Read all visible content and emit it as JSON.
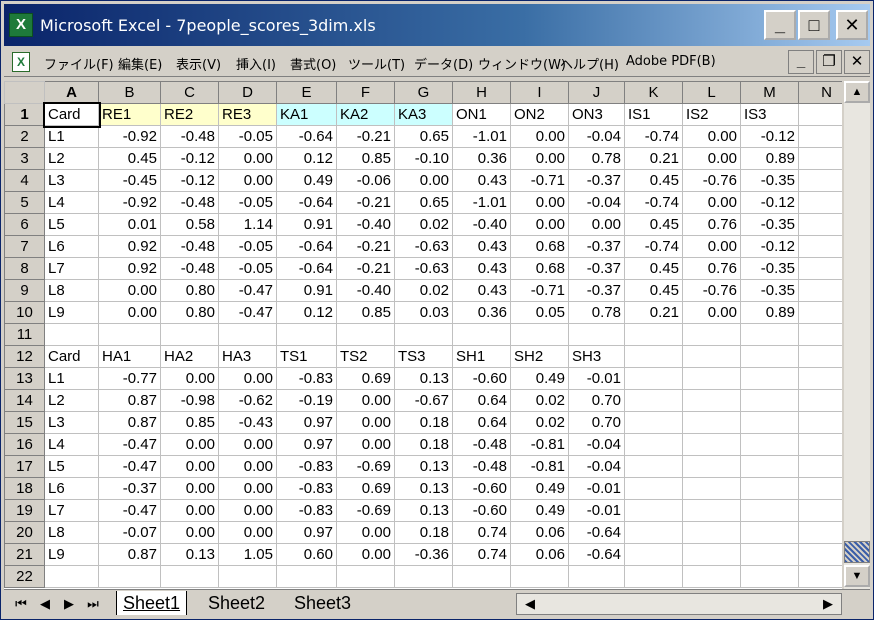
{
  "window": {
    "title": "Microsoft Excel - 7people_scores_3dim.xls",
    "app_icon": "excel-icon"
  },
  "menu": [
    "ファイル(F)",
    "編集(E)",
    "表示(V)",
    "挿入(I)",
    "書式(O)",
    "ツール(T)",
    "データ(D)",
    "ウィンドウ(W)",
    "ヘルプ(H)",
    "Adobe PDF(B)"
  ],
  "caption_buttons": {
    "minimize": "_",
    "maximize": "□",
    "close": "✕"
  },
  "mdi_buttons": {
    "minimize": "_",
    "restore": "❐",
    "close": "✕"
  },
  "columns": [
    "A",
    "B",
    "C",
    "D",
    "E",
    "F",
    "G",
    "H",
    "I",
    "J",
    "K",
    "L",
    "M",
    "N"
  ],
  "rows": [
    [
      "Card",
      "RE1",
      "RE2",
      "RE3",
      "KA1",
      "KA2",
      "KA3",
      "ON1",
      "ON2",
      "ON3",
      "IS1",
      "IS2",
      "IS3"
    ],
    [
      "L1",
      "-0.92",
      "-0.48",
      "-0.05",
      "-0.64",
      "-0.21",
      "0.65",
      "-1.01",
      "0.00",
      "-0.04",
      "-0.74",
      "0.00",
      "-0.12"
    ],
    [
      "L2",
      "0.45",
      "-0.12",
      "0.00",
      "0.12",
      "0.85",
      "-0.10",
      "0.36",
      "0.00",
      "0.78",
      "0.21",
      "0.00",
      "0.89"
    ],
    [
      "L3",
      "-0.45",
      "-0.12",
      "0.00",
      "0.49",
      "-0.06",
      "0.00",
      "0.43",
      "-0.71",
      "-0.37",
      "0.45",
      "-0.76",
      "-0.35"
    ],
    [
      "L4",
      "-0.92",
      "-0.48",
      "-0.05",
      "-0.64",
      "-0.21",
      "0.65",
      "-1.01",
      "0.00",
      "-0.04",
      "-0.74",
      "0.00",
      "-0.12"
    ],
    [
      "L5",
      "0.01",
      "0.58",
      "1.14",
      "0.91",
      "-0.40",
      "0.02",
      "-0.40",
      "0.00",
      "0.00",
      "0.45",
      "0.76",
      "-0.35"
    ],
    [
      "L6",
      "0.92",
      "-0.48",
      "-0.05",
      "-0.64",
      "-0.21",
      "-0.63",
      "0.43",
      "0.68",
      "-0.37",
      "-0.74",
      "0.00",
      "-0.12"
    ],
    [
      "L7",
      "0.92",
      "-0.48",
      "-0.05",
      "-0.64",
      "-0.21",
      "-0.63",
      "0.43",
      "0.68",
      "-0.37",
      "0.45",
      "0.76",
      "-0.35"
    ],
    [
      "L8",
      "0.00",
      "0.80",
      "-0.47",
      "0.91",
      "-0.40",
      "0.02",
      "0.43",
      "-0.71",
      "-0.37",
      "0.45",
      "-0.76",
      "-0.35"
    ],
    [
      "L9",
      "0.00",
      "0.80",
      "-0.47",
      "0.12",
      "0.85",
      "0.03",
      "0.36",
      "0.05",
      "0.78",
      "0.21",
      "0.00",
      "0.89"
    ],
    [],
    [
      "Card",
      "HA1",
      "HA2",
      "HA3",
      "TS1",
      "TS2",
      "TS3",
      "SH1",
      "SH2",
      "SH3"
    ],
    [
      "L1",
      "-0.77",
      "0.00",
      "0.00",
      "-0.83",
      "0.69",
      "0.13",
      "-0.60",
      "0.49",
      "-0.01"
    ],
    [
      "L2",
      "0.87",
      "-0.98",
      "-0.62",
      "-0.19",
      "0.00",
      "-0.67",
      "0.64",
      "0.02",
      "0.70"
    ],
    [
      "L3",
      "0.87",
      "0.85",
      "-0.43",
      "0.97",
      "0.00",
      "0.18",
      "0.64",
      "0.02",
      "0.70"
    ],
    [
      "L4",
      "-0.47",
      "0.00",
      "0.00",
      "0.97",
      "0.00",
      "0.18",
      "-0.48",
      "-0.81",
      "-0.04"
    ],
    [
      "L5",
      "-0.47",
      "0.00",
      "0.00",
      "-0.83",
      "-0.69",
      "0.13",
      "-0.48",
      "-0.81",
      "-0.04"
    ],
    [
      "L6",
      "-0.37",
      "0.00",
      "0.00",
      "-0.83",
      "0.69",
      "0.13",
      "-0.60",
      "0.49",
      "-0.01"
    ],
    [
      "L7",
      "-0.47",
      "0.00",
      "0.00",
      "-0.83",
      "-0.69",
      "0.13",
      "-0.60",
      "0.49",
      "-0.01"
    ],
    [
      "L8",
      "-0.07",
      "0.00",
      "0.00",
      "0.97",
      "0.00",
      "0.18",
      "0.74",
      "0.06",
      "-0.64"
    ],
    [
      "L9",
      "0.87",
      "0.13",
      "1.05",
      "0.60",
      "0.00",
      "-0.36",
      "0.74",
      "0.06",
      "-0.64"
    ],
    []
  ],
  "header_fill": {
    "RE": "#ffffcc",
    "KA": "#ccffff"
  },
  "sheets": [
    "Sheet1",
    "Sheet2",
    "Sheet3"
  ],
  "active_sheet": "Sheet1",
  "nav": {
    "first": "⏮",
    "prev": "◀",
    "next": "▶",
    "last": "⏭"
  }
}
